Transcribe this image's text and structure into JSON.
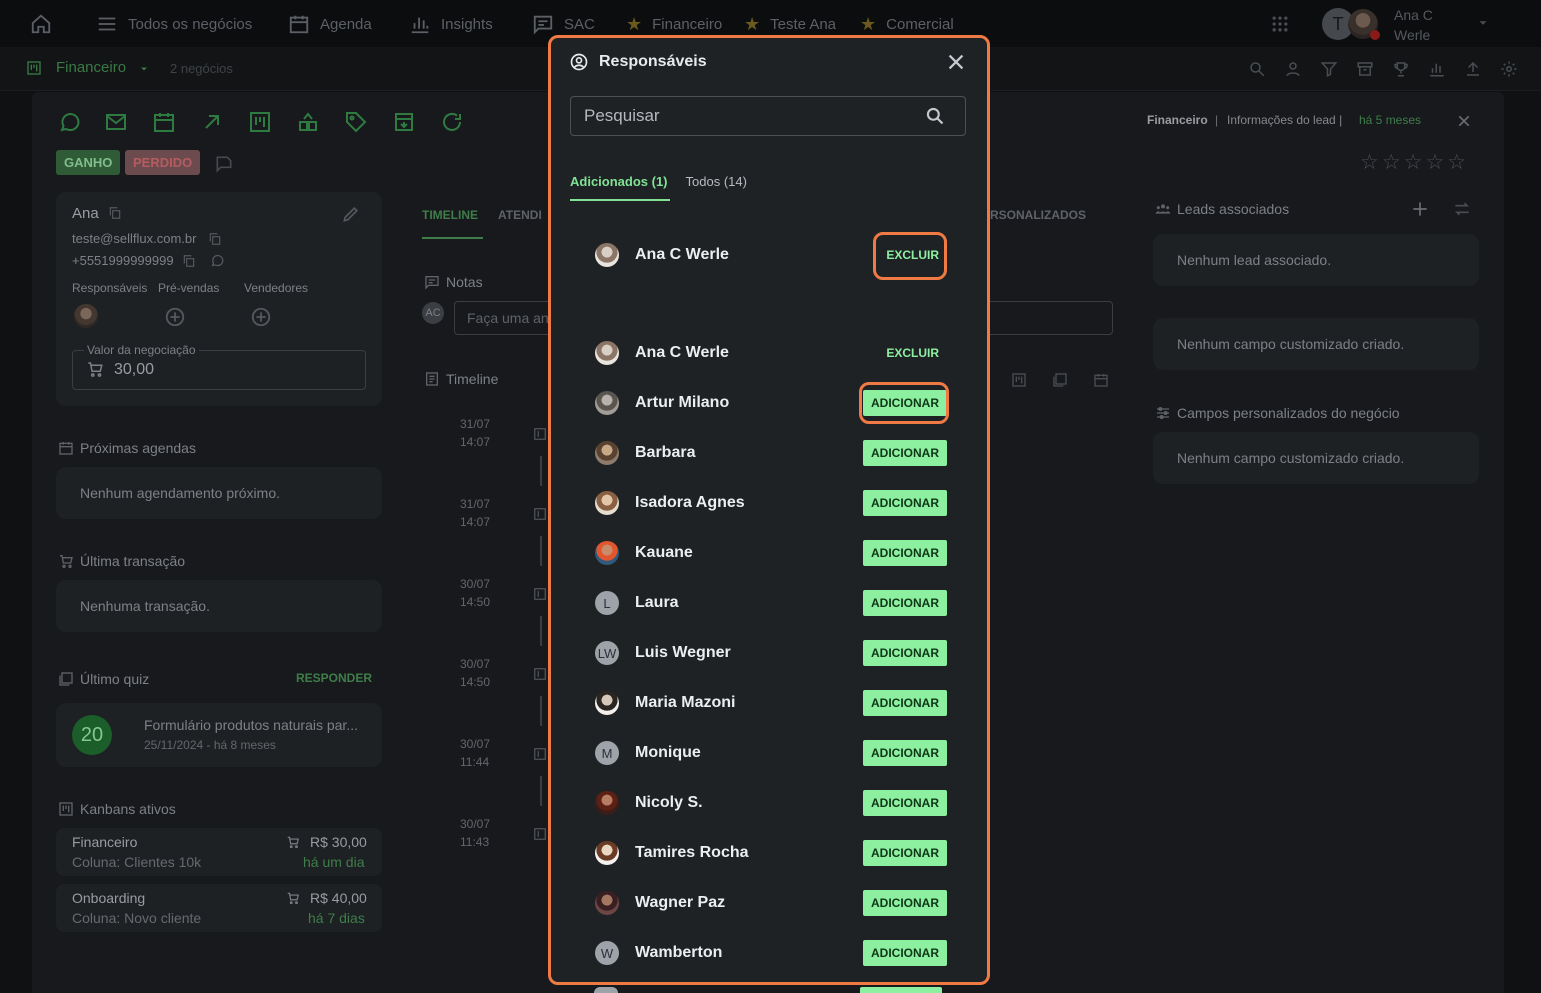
{
  "topnav": {
    "items": [
      "Todos os negócios",
      "Agenda",
      "Insights",
      "SAC",
      "Financeiro",
      "Teste Ana",
      "Comercial"
    ],
    "user_initial": "T",
    "user_name_1": "Ana C",
    "user_name_2": "Werle"
  },
  "subnav": {
    "title": "Financeiro",
    "count": "2 negócios"
  },
  "lead": {
    "tag_won": "GANHO",
    "tag_lost": "PERDIDO",
    "name": "Ana",
    "email": "teste@sellflux.com.br",
    "phone": "+5551999999999",
    "roles": [
      "Responsáveis",
      "Pré-vendas",
      "Vendedores"
    ],
    "deal_value_label": "Valor da negociação",
    "deal_value": "30,00",
    "next_schedules_title": "Próximas agendas",
    "next_schedules_empty": "Nenhum agendamento próximo.",
    "last_tx_title": "Última transação",
    "last_tx_empty": "Nenhuma transação.",
    "last_quiz_title": "Último quiz",
    "quiz_answer": "RESPONDER",
    "quiz_score": "20",
    "quiz_name": "Formulário produtos naturais par...",
    "quiz_date": "25/11/2024 - há 8 meses",
    "kanbans_title": "Kanbans ativos",
    "kanbans": [
      {
        "name": "Financeiro",
        "column": "Coluna: Clientes 10k",
        "value": "R$ 30,00",
        "when": "há um dia"
      },
      {
        "name": "Onboarding",
        "column": "Coluna: Novo cliente",
        "value": "R$ 40,00",
        "when": "há 7 dias"
      }
    ]
  },
  "middle": {
    "tab_timeline": "TIMELINE",
    "tab_atendi": "ATENDI",
    "tab_custom": "RSONALIZADOS",
    "notes_title": "Notas",
    "notes_initials": "AC",
    "notes_placeholder": "Faça uma an",
    "timeline_title": "Timeline",
    "timeline": [
      {
        "date": "31/07",
        "time": "14:07"
      },
      {
        "date": "31/07",
        "time": "14:07"
      },
      {
        "date": "30/07",
        "time": "14:50"
      },
      {
        "date": "30/07",
        "time": "14:50"
      },
      {
        "date": "30/07",
        "time": "11:44"
      },
      {
        "date": "30/07",
        "time": "11:43"
      }
    ]
  },
  "right": {
    "breadcrumb_kanban": "Financeiro",
    "breadcrumb_sep": "|",
    "breadcrumb_info": "Informações do lead |",
    "breadcrumb_time": "há 5 meses",
    "leads_title": "Leads associados",
    "leads_empty": "Nenhum lead associado.",
    "custom_empty": "Nenhum campo customizado criado.",
    "deal_custom_title": "Campos personalizados do negócio",
    "deal_custom_empty": "Nenhum campo customizado criado."
  },
  "modal": {
    "title": "Responsáveis",
    "search_placeholder": "Pesquisar",
    "tab_added": "Adicionados (1)",
    "tab_all": "Todos (14)",
    "remove_label": "EXCLUIR",
    "add_label": "ADICIONAR",
    "added": [
      {
        "name": "Ana C Werle",
        "avatar": "photo"
      }
    ],
    "users": [
      {
        "name": "Ana C Werle",
        "avatar": "photo",
        "action": "EXCLUIR"
      },
      {
        "name": "Artur Milano",
        "avatar": "photo",
        "action": "ADICIONAR"
      },
      {
        "name": "Barbara",
        "avatar": "photo",
        "action": "ADICIONAR"
      },
      {
        "name": "Isadora Agnes",
        "avatar": "photo",
        "action": "ADICIONAR"
      },
      {
        "name": "Kauane",
        "avatar": "photo",
        "action": "ADICIONAR"
      },
      {
        "name": "Laura",
        "avatar": "L",
        "action": "ADICIONAR"
      },
      {
        "name": "Luis Wegner",
        "avatar": "LW",
        "action": "ADICIONAR"
      },
      {
        "name": "Maria Mazoni",
        "avatar": "photo",
        "action": "ADICIONAR"
      },
      {
        "name": "Monique",
        "avatar": "M",
        "action": "ADICIONAR"
      },
      {
        "name": "Nicoly S.",
        "avatar": "photo",
        "action": "ADICIONAR"
      },
      {
        "name": "Tamires Rocha",
        "avatar": "photo",
        "action": "ADICIONAR"
      },
      {
        "name": "Wagner Paz",
        "avatar": "photo",
        "action": "ADICIONAR"
      },
      {
        "name": "Wamberton",
        "avatar": "W",
        "action": "ADICIONAR"
      }
    ]
  },
  "colors": {
    "accent": "#8df0a0",
    "brand_green": "#2e7b41",
    "highlight": "#f07a44",
    "modal_bg": "#1f2225"
  }
}
